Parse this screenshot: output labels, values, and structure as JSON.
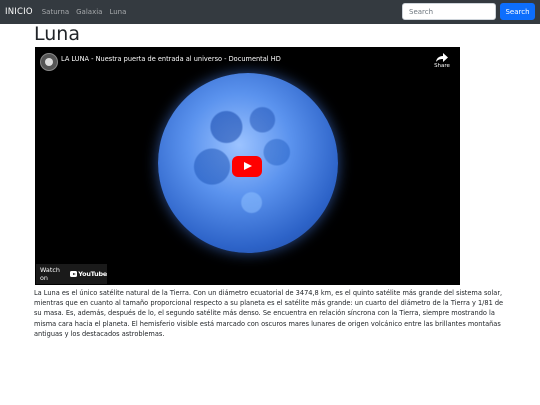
{
  "navbar": {
    "brand": "INICIO",
    "links": [
      "Saturna",
      "Galaxia",
      "Luna"
    ],
    "search_placeholder": "Search",
    "search_button": "Search"
  },
  "page": {
    "title": "Luna"
  },
  "video": {
    "title": "LA LUNA - Nuestra puerta de entrada al universo - Documental HD",
    "share_label": "Share",
    "watch_on": "Watch on",
    "youtube_label": "YouTube"
  },
  "description": "La Luna es el único satélite natural de la Tierra. Con un diámetro ecuatorial de 3474,8 km, es el quinto satélite más grande del sistema solar, mientras que en cuanto al tamaño proporcional respecto a su planeta es el satélite más grande: un cuarto del diámetro de la Tierra y 1/81 de su masa. Es, además, después de lo, el segundo satélite más denso. Se encuentra en relación síncrona con la Tierra, siempre mostrando la misma cara hacia el planeta. El hemisferio visible está marcado con oscuros mares lunares de origen volcánico entre las brillantes montañas antiguas y los destacados astroblemas.",
  "icons": {
    "play": "play-icon",
    "share": "share-icon",
    "youtube": "youtube-icon",
    "channel": "channel-avatar"
  },
  "colors": {
    "navbar": "#343a40",
    "primary": "#0d6efd",
    "play": "#ff0000"
  }
}
